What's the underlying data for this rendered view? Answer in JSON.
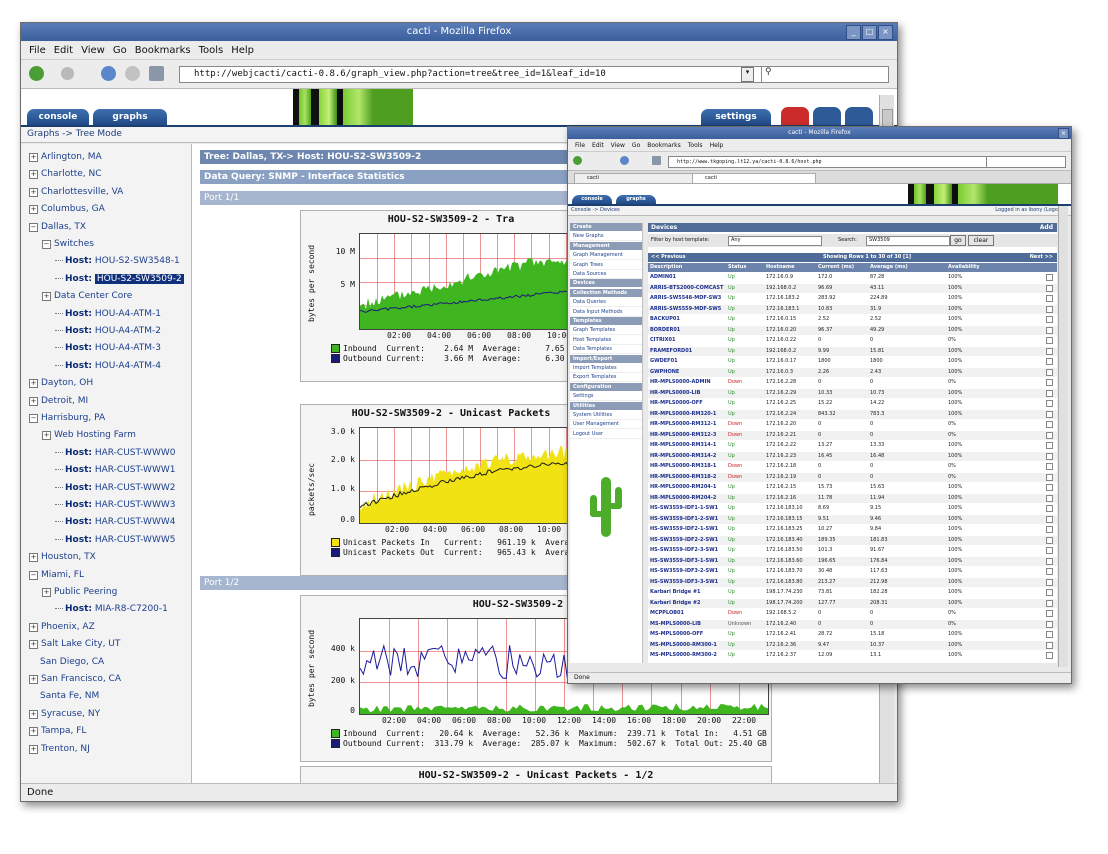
{
  "back_window": {
    "title": "cacti - Mozilla Firefox",
    "menu": [
      "File",
      "Edit",
      "View",
      "Go",
      "Bookmarks",
      "Tools",
      "Help"
    ],
    "url": "http://webjcacti/cacti-0.8.6/graph_view.php?action=tree&tree_id=1&leaf_id=10",
    "tabs": {
      "console": "console",
      "graphs": "graphs",
      "settings": "settings"
    },
    "breadcrumb": "Graphs -> Tree Mode",
    "tree": [
      {
        "label": "Arlington, MA",
        "level": 0,
        "icon": "plus"
      },
      {
        "label": "Charlotte, NC",
        "level": 0,
        "icon": "plus"
      },
      {
        "label": "Charlottesville, VA",
        "level": 0,
        "icon": "plus"
      },
      {
        "label": "Columbus, GA",
        "level": 0,
        "icon": "plus"
      },
      {
        "label": "Dallas, TX",
        "level": 0,
        "icon": "minus"
      },
      {
        "label": "Switches",
        "level": 1,
        "icon": "minus"
      },
      {
        "host": "Host:",
        "label": "HOU-S2-SW3548-1",
        "level": 2
      },
      {
        "host": "Host:",
        "label": "HOU-S2-SW3509-2",
        "level": 2,
        "selected": true
      },
      {
        "label": "Data Center Core",
        "level": 1,
        "icon": "plus"
      },
      {
        "host": "Host:",
        "label": "HOU-A4-ATM-1",
        "level": 2
      },
      {
        "host": "Host:",
        "label": "HOU-A4-ATM-2",
        "level": 2
      },
      {
        "host": "Host:",
        "label": "HOU-A4-ATM-3",
        "level": 2
      },
      {
        "host": "Host:",
        "label": "HOU-A4-ATM-4",
        "level": 2
      },
      {
        "label": "Dayton, OH",
        "level": 0,
        "icon": "plus"
      },
      {
        "label": "Detroit, MI",
        "level": 0,
        "icon": "plus"
      },
      {
        "label": "Harrisburg, PA",
        "level": 0,
        "icon": "minus"
      },
      {
        "label": "Web Hosting Farm",
        "level": 1,
        "icon": "plus"
      },
      {
        "host": "Host:",
        "label": "HAR-CUST-WWW0",
        "level": 2
      },
      {
        "host": "Host:",
        "label": "HAR-CUST-WWW1",
        "level": 2
      },
      {
        "host": "Host:",
        "label": "HAR-CUST-WWW2",
        "level": 2
      },
      {
        "host": "Host:",
        "label": "HAR-CUST-WWW3",
        "level": 2
      },
      {
        "host": "Host:",
        "label": "HAR-CUST-WWW4",
        "level": 2
      },
      {
        "host": "Host:",
        "label": "HAR-CUST-WWW5",
        "level": 2
      },
      {
        "label": "Houston, TX",
        "level": 0,
        "icon": "plus"
      },
      {
        "label": "Miami, FL",
        "level": 0,
        "icon": "minus"
      },
      {
        "label": "Public Peering",
        "level": 1,
        "icon": "plus"
      },
      {
        "host": "Host:",
        "label": "MIA-R8-C7200-1",
        "level": 2
      },
      {
        "label": "Phoenix, AZ",
        "level": 0,
        "icon": "plus"
      },
      {
        "label": "Salt Lake City, UT",
        "level": 0,
        "icon": "plus"
      },
      {
        "label": "San Diego, CA",
        "level": 0,
        "icon": "none"
      },
      {
        "label": "San Francisco, CA",
        "level": 0,
        "icon": "plus"
      },
      {
        "label": "Santa Fe, NM",
        "level": 0,
        "icon": "none"
      },
      {
        "label": "Syracuse, NY",
        "level": 0,
        "icon": "plus"
      },
      {
        "label": "Tampa, FL",
        "level": 0,
        "icon": "plus"
      },
      {
        "label": "Trenton, NJ",
        "level": 0,
        "icon": "plus"
      }
    ],
    "main": {
      "tree_header": "Tree: Dallas, TX-> Host: HOU-S2-SW3509-2",
      "data_query": "Data Query: SNMP - Interface Statistics",
      "part1": "Port 1/1",
      "part2": "Port 1/2"
    },
    "graphs": [
      {
        "title": "HOU-S2-SW3509-2 - Tra",
        "ylabel": "bytes per second",
        "yticks": [
          "10 M",
          "5 M"
        ],
        "xticks": [
          "02:00",
          "04:00",
          "06:00",
          "08:00",
          "10:00"
        ],
        "legend": [
          {
            "name": "Inbound",
            "text": "Inbound  Current:    2.64 M  Average:     7.65 M  Maxim"
          },
          {
            "name": "Outbound",
            "text": "Outbound Current:    3.66 M  Average:     6.30 M  Maxi"
          }
        ],
        "fill": "#3fb51f"
      },
      {
        "title": "HOU-S2-SW3509-2 - Unicast Packets",
        "ylabel": "packets/sec",
        "yticks": [
          "3.0 k",
          "2.0 k",
          "1.0 k",
          "0.0"
        ],
        "xticks": [
          "02:00",
          "04:00",
          "06:00",
          "08:00",
          "10:00",
          "12"
        ],
        "legend": [
          {
            "name": "Unicast Packets In",
            "text": "Unicast Packets In   Current:   961.19 k  Average:"
          },
          {
            "name": "Unicast Packets Out",
            "text": "Unicast Packets Out  Current:   965.43 k  Average:"
          }
        ],
        "fill": "#f1e213"
      },
      {
        "title": "HOU-S2-SW3509-2 - Tra",
        "ylabel": "bytes per second",
        "yticks": [
          "400 k",
          "200 k",
          "0"
        ],
        "xticks": [
          "02:00",
          "04:00",
          "06:00",
          "08:00",
          "10:00",
          "12:00",
          "14:00",
          "16:00",
          "18:00",
          "20:00",
          "22:00"
        ],
        "legend": [
          {
            "name": "Inbound",
            "text": "Inbound  Current:   20.64 k  Average:   52.36 k  Maximum:  239.71 k  Total In:   4.51 GB"
          },
          {
            "name": "Outbound",
            "text": "Outbound Current:  313.79 k  Average:  285.07 k  Maximum:  502.67 k  Total Out: 25.40 GB"
          }
        ],
        "fill": "#3fb51f"
      },
      {
        "title": "HOU-S2-SW3509-2 - Unicast Packets - 1/2",
        "ylabel": "",
        "yticks": [
          "0.0"
        ],
        "xticks": [],
        "legend": [],
        "fill": "#f1e213"
      }
    ],
    "status": "Done"
  },
  "front_window": {
    "title": "cacti - Mozilla Firefox",
    "menu": [
      "File",
      "Edit",
      "View",
      "Go",
      "Bookmarks",
      "Tools",
      "Help"
    ],
    "url": "http://www.tkgoping.lt12.ya/cacti-0.8.6/host.php",
    "page_tabs": [
      "cacti",
      "cacti"
    ],
    "tabs": {
      "console": "console",
      "graphs": "graphs"
    },
    "breadcrumb": "Console -> Devices",
    "logged": "Logged in as ibony (Logout)",
    "side": [
      {
        "type": "h",
        "label": "Create"
      },
      {
        "type": "i",
        "label": "New Graphs"
      },
      {
        "type": "h",
        "label": "Management"
      },
      {
        "type": "i",
        "label": "Graph Management"
      },
      {
        "type": "i",
        "label": "Graph Trees"
      },
      {
        "type": "i",
        "label": "Data Sources"
      },
      {
        "type": "h",
        "label": "Devices"
      },
      {
        "type": "h",
        "label": "Collection Methods"
      },
      {
        "type": "i",
        "label": "Data Queries"
      },
      {
        "type": "i",
        "label": "Data Input Methods"
      },
      {
        "type": "h",
        "label": "Templates"
      },
      {
        "type": "i",
        "label": "Graph Templates"
      },
      {
        "type": "i",
        "label": "Host Templates"
      },
      {
        "type": "i",
        "label": "Data Templates"
      },
      {
        "type": "h",
        "label": "Import/Export"
      },
      {
        "type": "i",
        "label": "Import Templates"
      },
      {
        "type": "i",
        "label": "Export Templates"
      },
      {
        "type": "h",
        "label": "Configuration"
      },
      {
        "type": "i",
        "label": "Settings"
      },
      {
        "type": "h",
        "label": "Utilities"
      },
      {
        "type": "i",
        "label": "System Utilities"
      },
      {
        "type": "i",
        "label": "User Management"
      },
      {
        "type": "i",
        "label": "Logout User"
      }
    ],
    "devices_title": "Devices",
    "add": "Add",
    "filter_label": "Filter by host template:",
    "filter_value": "Any",
    "search_label": "Search:",
    "search_value": "SW3509",
    "go": "go",
    "clear": "clear",
    "previous": "<< Previous",
    "showing": "Showing Rows 1 to 30 of 30 [1]",
    "next": "Next >>",
    "columns": [
      "Description",
      "Status",
      "Hostname",
      "Current (ms)",
      "Average (ms)",
      "Availability"
    ],
    "rows": [
      [
        "ADMIN01",
        "Up",
        "172.16.0.9",
        "172.0",
        "87.28",
        "100%"
      ],
      [
        "ARRIS-BTS2000-COMCAST",
        "Up",
        "192.168.0.2",
        "96.69",
        "43.11",
        "100%"
      ],
      [
        "ARRIS-SW5548-MDF-SW3",
        "Up",
        "172.16.183.2",
        "283.92",
        "224.89",
        "100%"
      ],
      [
        "ARRIS-SW5559-MDF-SW5",
        "Up",
        "172.16.183.1",
        "10.83",
        "31.9",
        "100%"
      ],
      [
        "BACKUP01",
        "Up",
        "172.16.0.15",
        "2.52",
        "2.52",
        "100%"
      ],
      [
        "BORDER01",
        "Up",
        "172.16.0.20",
        "96.37",
        "49.29",
        "100%"
      ],
      [
        "CITRIX01",
        "Up",
        "172.16.0.22",
        "0",
        "0",
        "0%"
      ],
      [
        "FRAMEFORD01",
        "Up",
        "192.168.0.2",
        "9.99",
        "15.81",
        "100%"
      ],
      [
        "GWDEF01",
        "Up",
        "172.16.0.17",
        "1800",
        "1800",
        "100%"
      ],
      [
        "GWPHONE",
        "Up",
        "172.16.0.3",
        "2.26",
        "2.43",
        "100%"
      ],
      [
        "HR-MPLS0000-ADMIN",
        "Down",
        "172.16.2.28",
        "0",
        "0",
        "0%"
      ],
      [
        "HR-MPLS0000-LIB",
        "Up",
        "172.16.2.29",
        "10.33",
        "10.73",
        "100%"
      ],
      [
        "HR-MPLS0000-OFF",
        "Up",
        "172.16.2.25",
        "15.22",
        "14.22",
        "100%"
      ],
      [
        "HR-MPLS0000-RM320-1",
        "Up",
        "172.16.2.24",
        "843.32",
        "783.3",
        "100%"
      ],
      [
        "HR-MPLS0000-RM312-1",
        "Down",
        "172.16.2.20",
        "0",
        "0",
        "0%"
      ],
      [
        "HR-MPLS0000-RM312-3",
        "Down",
        "172.16.2.21",
        "0",
        "0",
        "0%"
      ],
      [
        "HR-MPLS0000-RM314-1",
        "Up",
        "172.16.2.22",
        "13.27",
        "13.33",
        "100%"
      ],
      [
        "HR-MPLS0000-RM314-2",
        "Up",
        "172.16.2.23",
        "16.45",
        "16.48",
        "100%"
      ],
      [
        "HR-MPLS0000-RM318-1",
        "Down",
        "172.16.2.18",
        "0",
        "0",
        "0%"
      ],
      [
        "HR-MPLS0000-RM318-2",
        "Down",
        "172.16.2.19",
        "0",
        "0",
        "0%"
      ],
      [
        "HR-MPLS0000-RM204-1",
        "Up",
        "172.16.2.15",
        "15.73",
        "15.63",
        "100%"
      ],
      [
        "HR-MPLS0000-RM204-2",
        "Up",
        "172.16.2.16",
        "11.78",
        "11.94",
        "100%"
      ],
      [
        "HS-SW3559-IDF1-1-SW1",
        "Up",
        "172.16.183.10",
        "8.69",
        "9.15",
        "100%"
      ],
      [
        "HS-SW3559-IDF1-2-SW1",
        "Up",
        "172.16.183.15",
        "9.51",
        "9.46",
        "100%"
      ],
      [
        "HS-SW3559-IDF2-1-SW1",
        "Up",
        "172.16.183.25",
        "10.27",
        "9.84",
        "100%"
      ],
      [
        "HS-SW3559-IDF2-2-SW1",
        "Up",
        "172.16.183.40",
        "189.35",
        "181.83",
        "100%"
      ],
      [
        "HS-SW3559-IDF2-3-SW1",
        "Up",
        "172.16.183.50",
        "101.3",
        "91.67",
        "100%"
      ],
      [
        "HS-SW3559-IDF3-1-SW1",
        "Up",
        "172.16.183.60",
        "196.65",
        "176.84",
        "100%"
      ],
      [
        "HS-SW3559-IDF3-2-SW1",
        "Up",
        "172.16.183.70",
        "30.48",
        "117.63",
        "100%"
      ],
      [
        "HS-SW3559-IDF3-3-SW1",
        "Up",
        "172.16.183.80",
        "213.27",
        "212.98",
        "100%"
      ],
      [
        "Karbari Bridge #1",
        "Up",
        "198.17.74.230",
        "73.81",
        "182.28",
        "100%"
      ],
      [
        "Karbari Bridge #2",
        "Up",
        "198.17.74.200",
        "127.77",
        "208.31",
        "100%"
      ],
      [
        "MCPPLOB01",
        "Down",
        "192.168.5.2",
        "0",
        "0",
        "0%"
      ],
      [
        "MS-MPLS0000-LIB",
        "Unknown",
        "172.16.2.40",
        "0",
        "0",
        "0%"
      ],
      [
        "MS-MPLS0000-OFF",
        "Up",
        "172.16.2.41",
        "28.72",
        "15.18",
        "100%"
      ],
      [
        "MS-MPLS0000-RM300-1",
        "Up",
        "172.16.2.36",
        "9.47",
        "10.37",
        "100%"
      ],
      [
        "MS-MPLS0000-RM300-2",
        "Up",
        "172.16.2.37",
        "12.09",
        "13.1",
        "100%"
      ]
    ],
    "status": "Done"
  },
  "colors": {
    "title": "#3b5f9d",
    "tab": "#2a5592",
    "host": "#0b2b74",
    "selected": "#102f7c",
    "up": "#2e8b2e",
    "down": "#cc2222"
  }
}
